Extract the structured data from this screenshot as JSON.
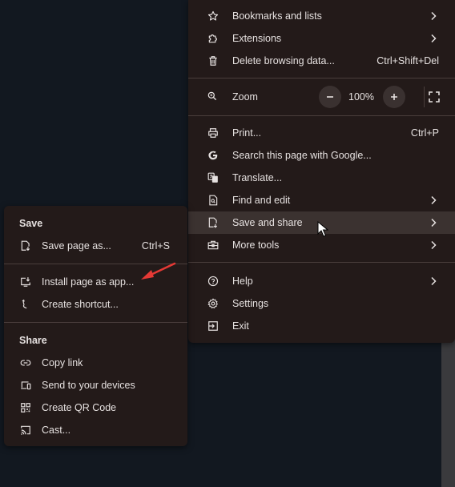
{
  "main_menu": {
    "items_top": [
      {
        "label": "Bookmarks and lists",
        "icon": "star-icon",
        "has_submenu": true
      },
      {
        "label": "Extensions",
        "icon": "puzzle-icon",
        "has_submenu": true
      },
      {
        "label": "Delete browsing data...",
        "icon": "trash-icon",
        "shortcut": "Ctrl+Shift+Del"
      }
    ],
    "zoom": {
      "label": "Zoom",
      "minus": "−",
      "value": "100%",
      "plus": "+"
    },
    "items_mid": [
      {
        "label": "Print...",
        "icon": "printer-icon",
        "shortcut": "Ctrl+P"
      },
      {
        "label": "Search this page with Google...",
        "icon": "google-icon"
      },
      {
        "label": "Translate...",
        "icon": "translate-icon"
      },
      {
        "label": "Find and edit",
        "icon": "find-icon",
        "has_submenu": true
      },
      {
        "label": "Save and share",
        "icon": "save-share-icon",
        "has_submenu": true,
        "hovered": true
      },
      {
        "label": "More tools",
        "icon": "toolbox-icon",
        "has_submenu": true
      }
    ],
    "items_bottom": [
      {
        "label": "Help",
        "icon": "help-icon",
        "has_submenu": true
      },
      {
        "label": "Settings",
        "icon": "gear-icon"
      },
      {
        "label": "Exit",
        "icon": "exit-icon"
      }
    ]
  },
  "sub_menu": {
    "save_title": "Save",
    "save_items": [
      {
        "label": "Save page as...",
        "icon": "save-page-icon",
        "shortcut": "Ctrl+S"
      },
      {
        "label": "Install page as app...",
        "icon": "install-app-icon"
      },
      {
        "label": "Create shortcut...",
        "icon": "shortcut-icon"
      }
    ],
    "share_title": "Share",
    "share_items": [
      {
        "label": "Copy link",
        "icon": "link-icon"
      },
      {
        "label": "Send to your devices",
        "icon": "devices-icon"
      },
      {
        "label": "Create QR Code",
        "icon": "qr-code-icon"
      },
      {
        "label": "Cast...",
        "icon": "cast-icon"
      }
    ]
  },
  "colors": {
    "menu_bg": "#231a19",
    "hover_bg": "#3b3230",
    "annotation_arrow": "#e53935",
    "page_bg": "#121820"
  }
}
